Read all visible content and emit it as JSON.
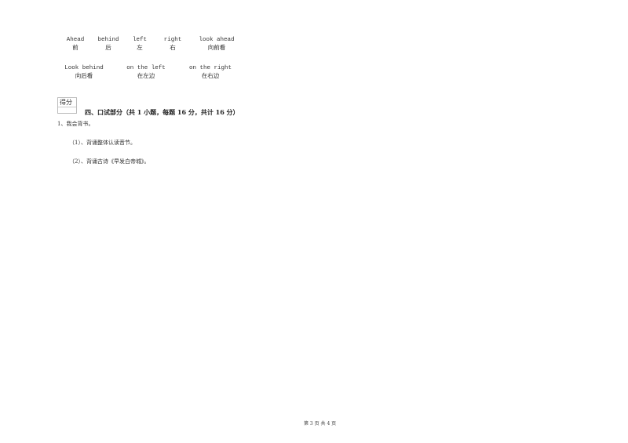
{
  "vocab_rows": [
    [
      {
        "en": "Ahead",
        "zh": "前"
      },
      {
        "en": "behind",
        "zh": "后"
      },
      {
        "en": "left",
        "zh": "左"
      },
      {
        "en": "right",
        "zh": "右"
      },
      {
        "en": "look ahead",
        "zh": "向前看"
      }
    ],
    [
      {
        "en": "Look behind",
        "zh": "向后看"
      },
      {
        "en": "on the left",
        "zh": "在左边"
      },
      {
        "en": "on the right",
        "zh": "在右边"
      }
    ]
  ],
  "score_box": {
    "label": "得分"
  },
  "section": {
    "title": "四、口试部分（共 1 小题，每题 16 分，共计 16 分）",
    "question": "1、我会背书。",
    "items": [
      "（1）、背诵整体认读音节。",
      "（2）、背诵古诗《早发白帝城》。"
    ]
  },
  "footer": {
    "page": "第 3 页 共 4 页"
  }
}
